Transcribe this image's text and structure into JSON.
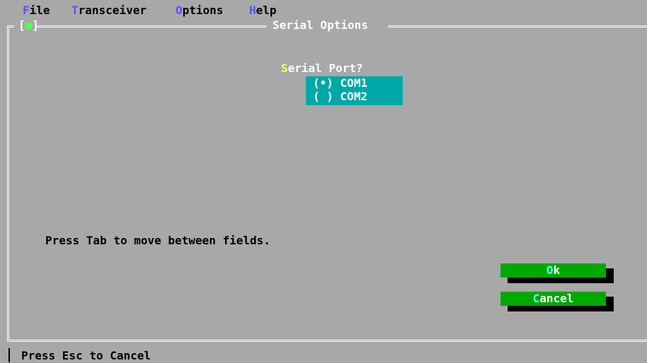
{
  "menu": {
    "file": {
      "hotkey": "F",
      "rest": "ile"
    },
    "transceiver": {
      "hotkey": "T",
      "rest": "ransceiver"
    },
    "options": {
      "hotkey": "O",
      "rest": "ptions"
    },
    "help": {
      "hotkey": "H",
      "rest": "elp"
    }
  },
  "window": {
    "title": "Serial Options",
    "close_left": "[",
    "close_dot": "■",
    "close_right": "]"
  },
  "serial": {
    "label_hotkey": "S",
    "label_rest": "erial Port?",
    "options": [
      {
        "marker": "(•)",
        "label": "COM1",
        "selected": true
      },
      {
        "marker": "( )",
        "label": "COM2",
        "selected": false
      }
    ]
  },
  "hint": "Press Tab to move between fields.",
  "buttons": {
    "ok": {
      "hotkey": "O",
      "rest": "k"
    },
    "cancel": {
      "hotkey": "C",
      "rest": "ancel"
    }
  },
  "status": "Press Esc to Cancel",
  "colors": {
    "background": "#a8a8a8",
    "menu_hotkey": "#5454fc",
    "list_bg": "#00a8a8",
    "button_bg": "#00a800",
    "button_hotkey": "#54fcfc",
    "label_hotkey": "#fcfc54"
  }
}
